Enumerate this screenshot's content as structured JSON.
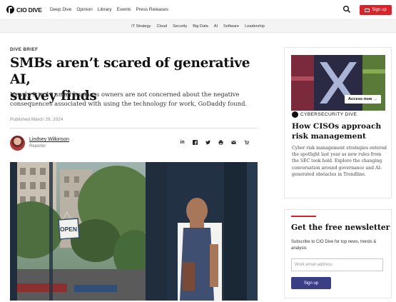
{
  "header": {
    "logo_text": "CIO DIVE",
    "nav": [
      "Deep Dive",
      "Opinion",
      "Library",
      "Events",
      "Press Releases"
    ],
    "signup_label": "Sign up",
    "accent_color": "#d8232a"
  },
  "section_nav": [
    "IT Strategy",
    "Cloud",
    "Security",
    "Big Data",
    "AI",
    "Software",
    "Leadership"
  ],
  "article": {
    "eyebrow": "DIVE BRIEF",
    "headline_line1": "SMBs aren’t scared of generative AI,",
    "headline_line2": "survey finds",
    "dek": "Nearly 9 in 10 small business owners are not concerned about the negative consequences associated with using the technology for work, GoDaddy found.",
    "published": "Published March 29, 2024",
    "author_name": "Lindsey Wilkinson",
    "author_role": "Reporter",
    "share_icons": [
      "linkedin-icon",
      "facebook-icon",
      "twitter-icon",
      "print-icon",
      "email-icon",
      "license-icon"
    ],
    "hero_sign": "OPEN"
  },
  "sidebar_ad": {
    "cta": "Access now",
    "brand": "CYBERSECURITY DIVE",
    "title": "How CISOs approach risk management",
    "body": "Cyber risk management strategies entered the spotlight last year as new rules from the SEC took hold. Explore the changing conversation around governance and AI-generated obstacles in Trendline."
  },
  "newsletter": {
    "title": "Get the free newsletter",
    "body": "Subscribe to CIO Dive for top news, trends & analysis",
    "placeholder": "Work email address",
    "button": "Sign up",
    "button_color": "#3a3f85"
  }
}
